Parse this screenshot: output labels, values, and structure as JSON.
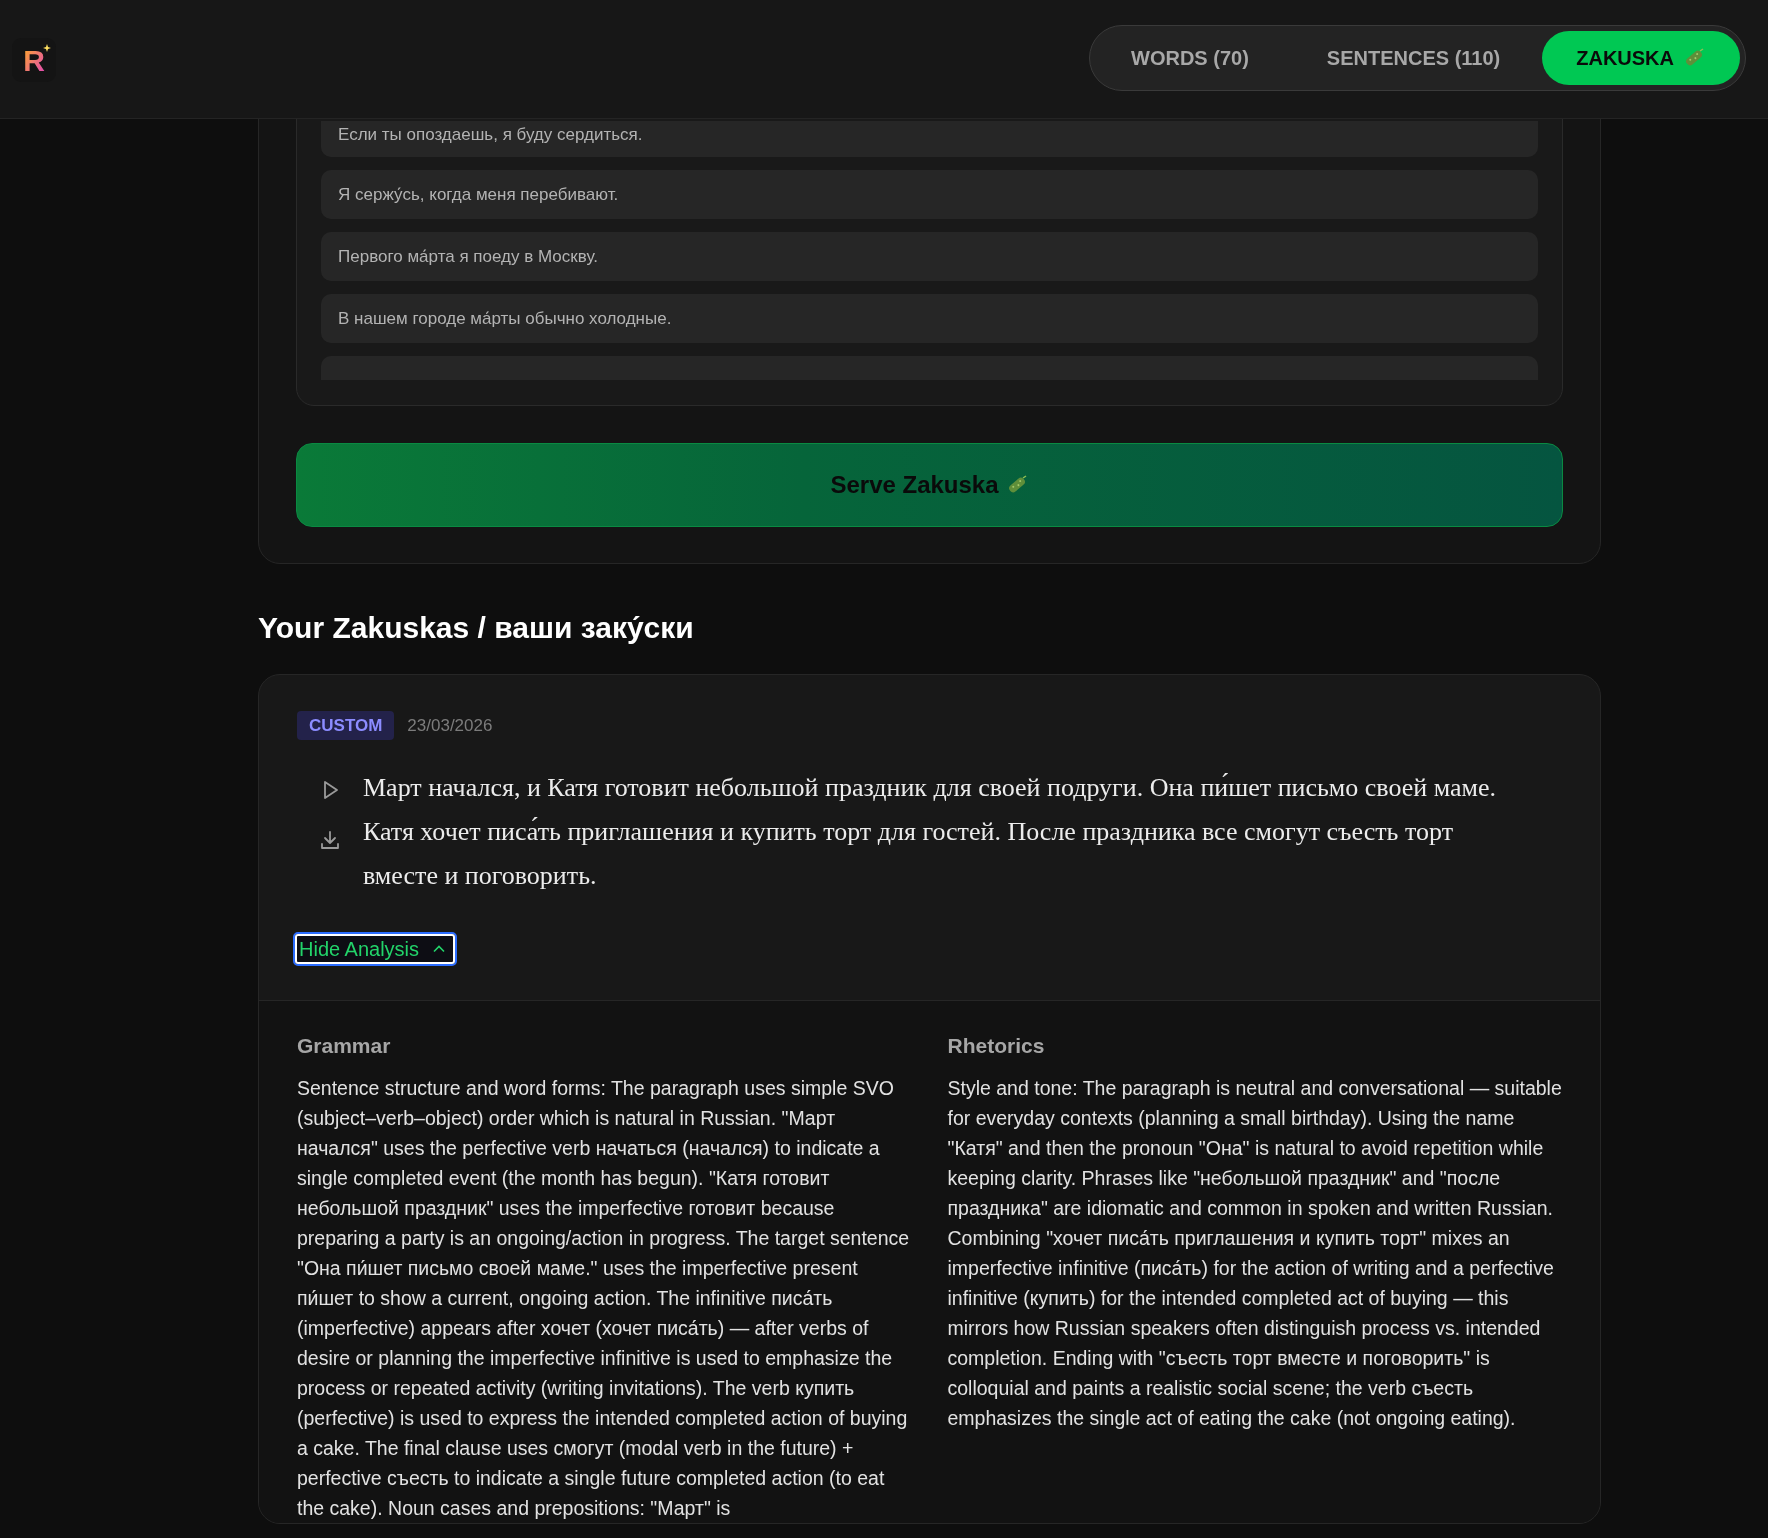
{
  "logo": {
    "letter": "R"
  },
  "tabs": [
    {
      "label": "WORDS (70)",
      "selected": false,
      "icon": false
    },
    {
      "label": "SENTENCES (110)",
      "selected": false,
      "icon": false
    },
    {
      "label": "ZAKUSKA",
      "selected": true,
      "icon": true
    }
  ],
  "sentences": [
    "Если ты опоздаешь, я буду сердиться.",
    "Я сержу́сь, когда меня перебивают.",
    "Первого ма́рта я поеду в Москву.",
    "В нашем городе ма́рты обычно холодные."
  ],
  "serve_button": {
    "label": "Serve Zakuska"
  },
  "heading": "Your Zakuskas / ваши заку́ски",
  "zakuskas": [
    {
      "badge": "CUSTOM",
      "date": "23/03/2026",
      "text": "Март начался, и Катя готовит небольшой праздник для своей подруги. Она пи́шет письмо своей маме. Катя хочет писа́ть приглашения и купить торт для гостей. После праздника все смогут съесть торт вместе и поговорить.",
      "toggle": {
        "label": "Hide Analysis",
        "expanded": true,
        "focused": true
      },
      "analysis": [
        {
          "title": "Grammar",
          "text": "Sentence structure and word forms: The paragraph uses simple SVO (subject–verb–object) order which is natural in Russian. \"Март начался\" uses the perfective verb начаться (начался) to indicate a single completed event (the month has begun). \"Катя готовит небольшой праздник\" uses the imperfective готовит because preparing a party is an ongoing/action in progress. The target sentence \"Она пи́шет письмо своей маме.\" uses the imperfective present пи́шет to show a current, ongoing action. The infinitive писа́ть (imperfective) appears after хочет (хочет писа́ть) — after verbs of desire or planning the imperfective infinitive is used to emphasize the process or repeated activity (writing invitations). The verb купить (perfective) is used to express the intended completed action of buying a cake. The final clause uses смогут (modal verb in the future) + perfective съесть to indicate a single future completed action (to eat the cake). Noun cases and prepositions: \"Март\" is"
        },
        {
          "title": "Rhetorics",
          "text": "Style and tone: The paragraph is neutral and conversational — suitable for everyday contexts (planning a small birthday). Using the name \"Катя\" and then the pronoun \"Она\" is natural to avoid repetition while keeping clarity. Phrases like \"небольшой праздник\" and \"после праздника\" are idiomatic and common in spoken and written Russian. Combining \"хочет писа́ть приглашения и купить торт\" mixes an imperfective infinitive (писа́ть) for the action of writing and a perfective infinitive (купить) for the intended completed act of buying — this mirrors how Russian speakers often distinguish process vs. intended completion. Ending with \"съесть торт вместе и поговорить\" is colloquial and paints a realistic social scene; the verb съесть emphasizes the single act of eating the cake (not ongoing eating)."
        }
      ]
    }
  ]
}
